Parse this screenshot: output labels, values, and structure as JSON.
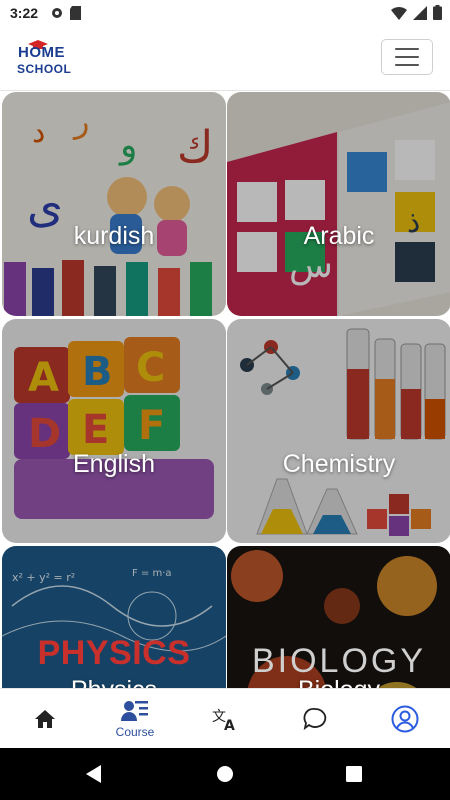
{
  "status_bar": {
    "time": "3:22"
  },
  "header": {
    "logo_line1": "HOME",
    "logo_line2": "SCHOOL",
    "menu_icon": "hamburger-icon"
  },
  "courses": [
    {
      "name": "kurdish"
    },
    {
      "name": "Arabic"
    },
    {
      "name": "English"
    },
    {
      "name": "Chemistry"
    },
    {
      "name": "Physics",
      "image_text": "PHYSICS"
    },
    {
      "name": "Biology",
      "image_text": "BIOLOGY"
    }
  ],
  "bottom_nav": {
    "items": [
      {
        "icon": "home-icon",
        "label": ""
      },
      {
        "icon": "course-icon",
        "label": "Course"
      },
      {
        "icon": "translate-icon",
        "label": ""
      },
      {
        "icon": "chat-icon",
        "label": ""
      },
      {
        "icon": "profile-icon",
        "label": ""
      }
    ],
    "accent": "#2d4f9e",
    "active_profile": "#2b5ce0"
  }
}
